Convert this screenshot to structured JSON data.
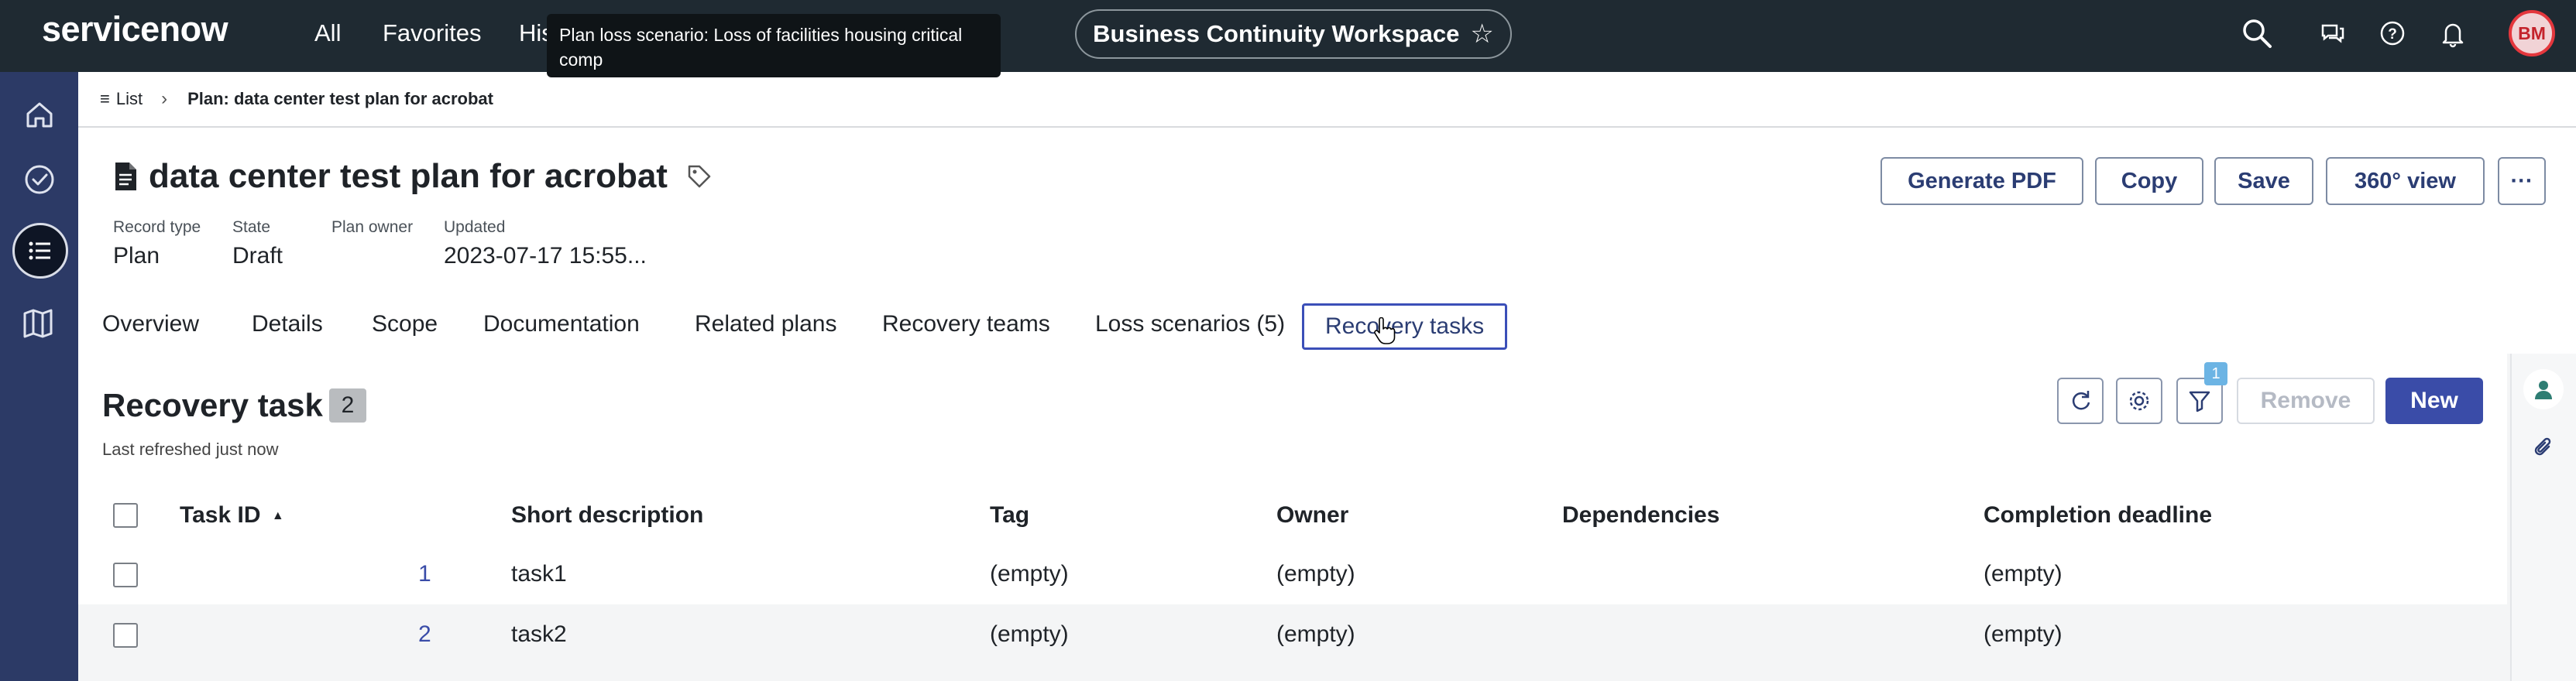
{
  "topbar": {
    "logo": "servicenow",
    "nav": [
      "All",
      "Favorites",
      "His"
    ],
    "tooltip": "Plan loss scenario: Loss of facilities housing critical comp",
    "workspace": "Business Continuity Workspace",
    "avatar_initials": "BM"
  },
  "breadcrumb": {
    "list_label": "List",
    "current": "Plan: data center test plan for acrobat"
  },
  "record": {
    "title": "data center test plan for acrobat",
    "meta": [
      {
        "label": "Record type",
        "value": "Plan"
      },
      {
        "label": "State",
        "value": "Draft"
      },
      {
        "label": "Plan owner",
        "value": ""
      },
      {
        "label": "Updated",
        "value": "2023-07-17 15:55..."
      }
    ],
    "actions": {
      "generate_pdf": "Generate PDF",
      "copy": "Copy",
      "save": "Save",
      "view360": "360° view",
      "more": "···"
    }
  },
  "tabs": [
    "Overview",
    "Details",
    "Scope",
    "Documentation",
    "Related plans",
    "Recovery teams",
    "Loss scenarios (5)",
    "Recovery tasks"
  ],
  "list": {
    "title": "Recovery task",
    "count": "2",
    "refreshed": "Last refreshed just now",
    "filter_badge": "1",
    "remove_label": "Remove",
    "new_label": "New",
    "columns": [
      "Task ID",
      "Short description",
      "Tag",
      "Owner",
      "Dependencies",
      "Completion deadline"
    ],
    "sort_indicator": "▲",
    "rows": [
      {
        "id": "1",
        "short_description": "task1",
        "tag": "(empty)",
        "owner": "(empty)",
        "dependencies": "",
        "deadline": "(empty)"
      },
      {
        "id": "2",
        "short_description": "task2",
        "tag": "(empty)",
        "owner": "(empty)",
        "dependencies": "",
        "deadline": "(empty)"
      }
    ]
  },
  "colors": {
    "topbar": "#1f2a32",
    "rail": "#2c3a66",
    "accent": "#3a4ca8",
    "active_tab_border": "#3b4fb8"
  }
}
